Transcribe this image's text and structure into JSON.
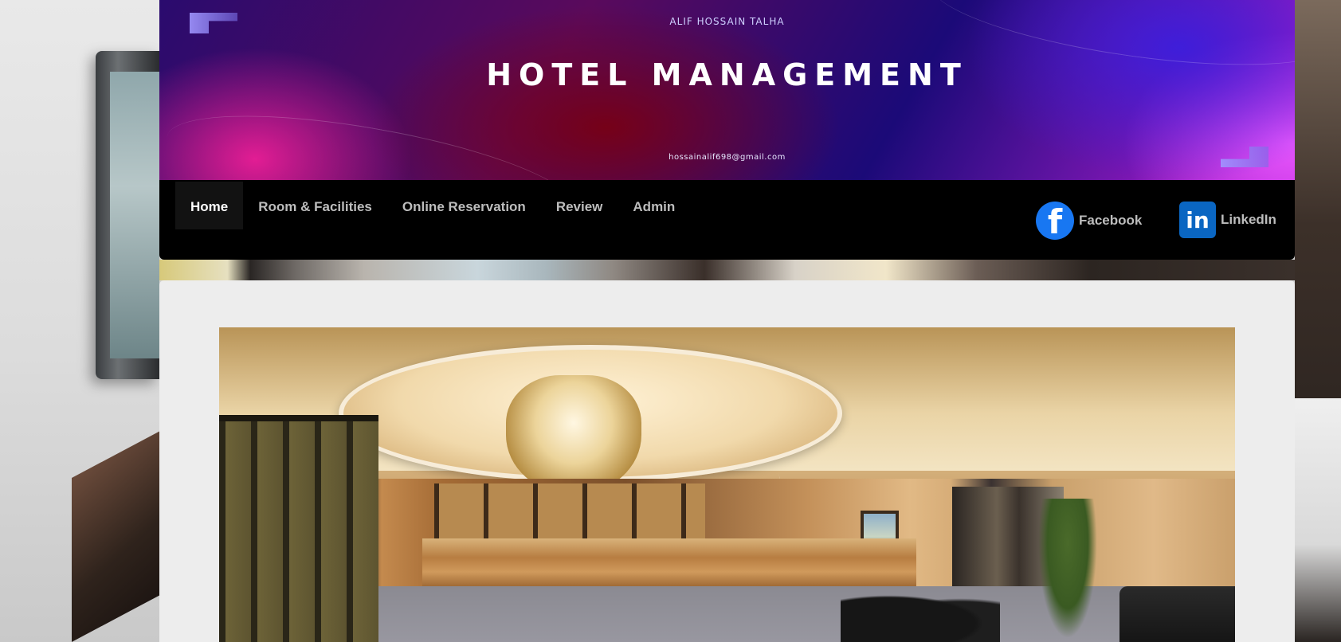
{
  "banner": {
    "author": "ALIF HOSSAIN TALHA",
    "title": "HOTEL MANAGEMENT",
    "email": "hossainalif698@gmail.com"
  },
  "nav": {
    "items": [
      {
        "label": "Home",
        "active": true
      },
      {
        "label": "Room & Facilities",
        "active": false
      },
      {
        "label": "Online Reservation",
        "active": false
      },
      {
        "label": "Review",
        "active": false
      },
      {
        "label": "Admin",
        "active": false
      }
    ]
  },
  "social": {
    "facebook": {
      "label": "Facebook",
      "icon": "facebook-icon",
      "glyph": "f",
      "color": "#1877f2"
    },
    "linkedin": {
      "label": "LinkedIn",
      "icon": "linkedin-icon",
      "glyph": "in",
      "color": "#0a66c2"
    }
  },
  "colors": {
    "navbar_bg": "#000000",
    "nav_text": "#bdbdbd",
    "nav_active_text": "#ffffff",
    "content_bg": "#ededed"
  }
}
